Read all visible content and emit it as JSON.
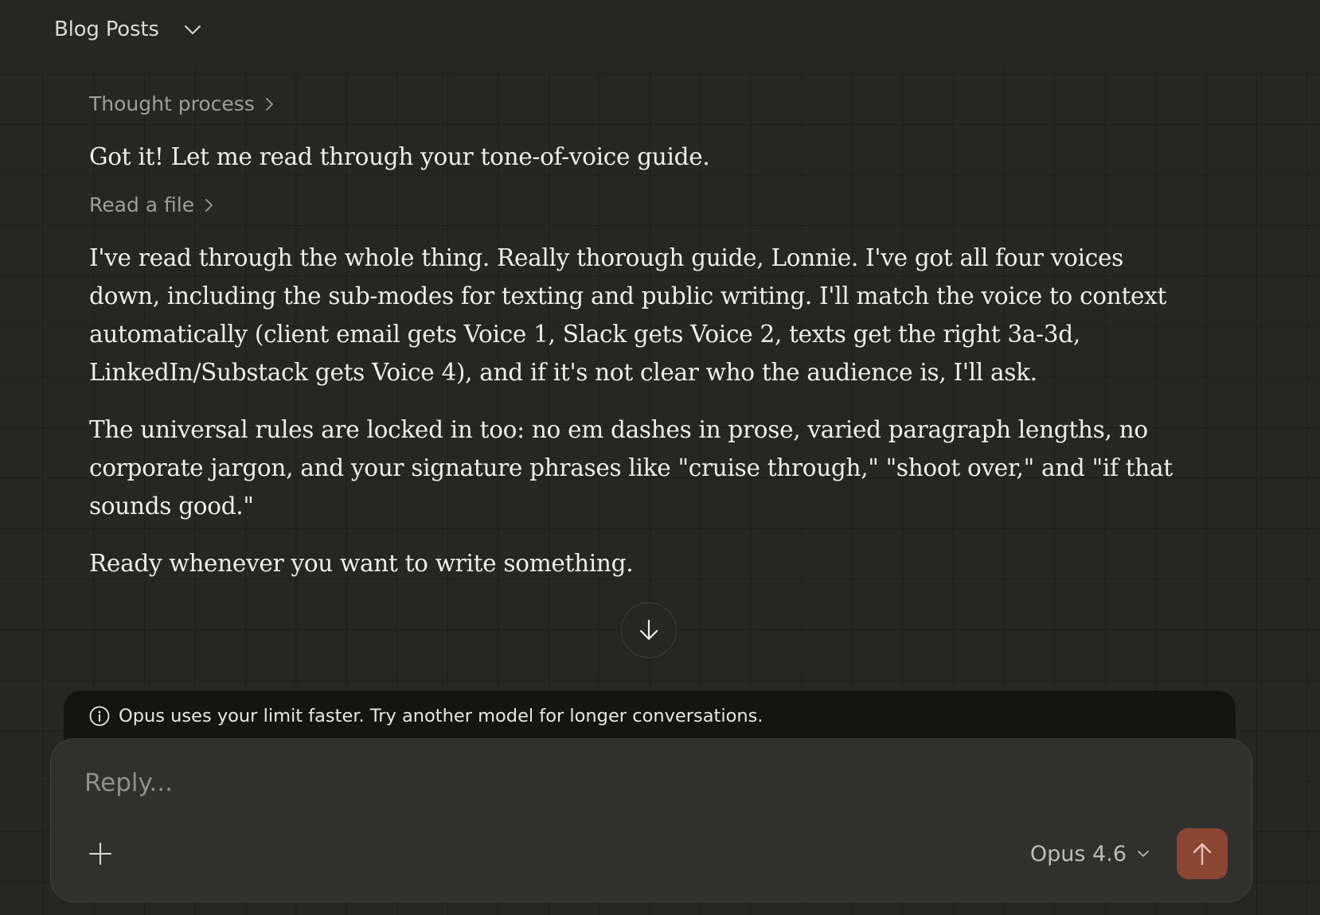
{
  "header": {
    "project_title": "Blog Posts"
  },
  "conversation": {
    "thought_process_label": "Thought process",
    "intro_message": "Got it! Let me read through your tone-of-voice guide.",
    "tool_call_label": "Read a file",
    "paragraphs": [
      "I've read through the whole thing. Really thorough guide, Lonnie. I've got all four voices down, including the sub-modes for texting and public writing. I'll match the voice to context automatically (client email gets Voice 1, Slack gets Voice 2, texts get the right 3a-3d, LinkedIn/Substack gets Voice 4), and if it's not clear who the audience is, I'll ask.",
      "The universal rules are locked in too: no em dashes in prose, varied paragraph lengths, no corporate jargon, and your signature phrases like \"cruise through,\" \"shoot over,\" and \"if that sounds good.\"",
      "Ready whenever you want to write something."
    ]
  },
  "notice": {
    "text": "Opus uses your limit faster. Try another model for longer conversations."
  },
  "composer": {
    "placeholder": "Reply...",
    "model_name": "Opus 4.6"
  },
  "colors": {
    "background": "#262625",
    "composer": "#30302e",
    "notice": "#141413",
    "send_button": "#8a4633"
  },
  "icons": {
    "project_dropdown": "chevron-down-icon",
    "expand": "chevron-right-icon",
    "scroll_down": "arrow-down-icon",
    "info": "info-icon",
    "add": "plus-icon",
    "model_dropdown": "chevron-down-icon",
    "send": "arrow-up-icon"
  }
}
